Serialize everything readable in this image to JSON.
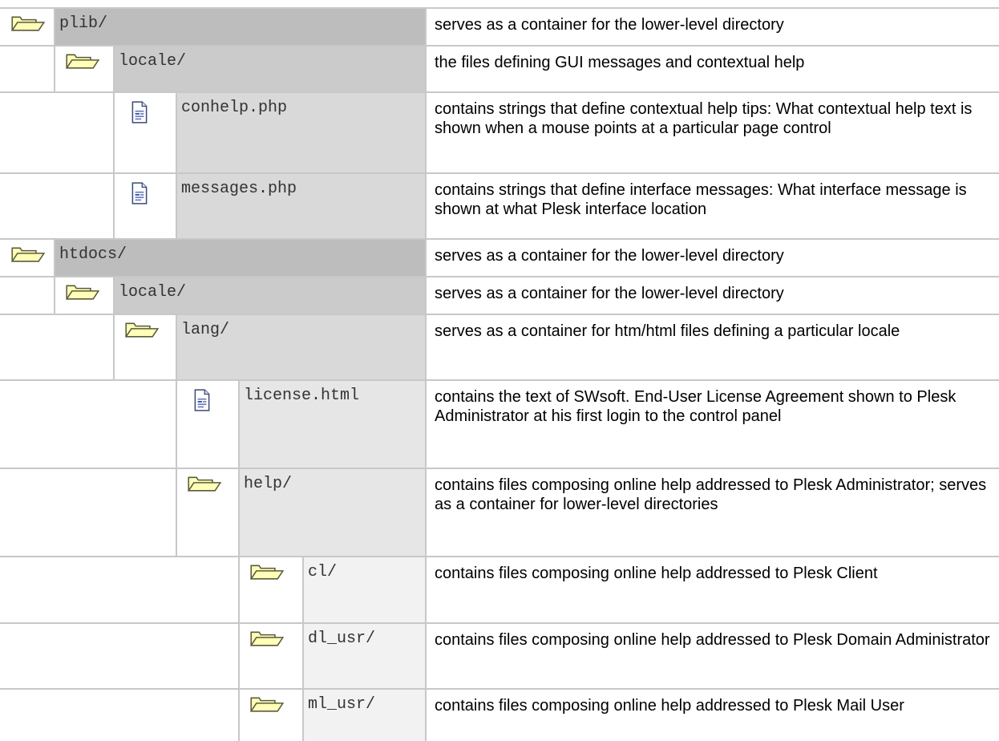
{
  "colors": {
    "level0_name_bg": "#bdbdbd",
    "level1_name_bg": "#cbcbcb",
    "level2_name_bg": "#d9d9d9",
    "level3_name_bg": "#e6e6e6",
    "level4_name_bg": "#f2f2f2",
    "grid_line": "#c8c8c8",
    "folder_fill": "#ffffb8",
    "folder_stroke": "#5a5a3c"
  },
  "rows": [
    {
      "level": 0,
      "icon": "folder-icon",
      "name": "plib/",
      "description": "serves as a container for the lower-level directory"
    },
    {
      "level": 1,
      "icon": "folder-icon",
      "name": "locale/",
      "description": "the files defining GUI messages and contextual help"
    },
    {
      "level": 2,
      "icon": "document-icon",
      "name": "conhelp.php",
      "description": "contains strings that define contextual help tips: What contextual help text is shown when a mouse points at a particular page control"
    },
    {
      "level": 2,
      "icon": "document-icon",
      "name": "messages.php",
      "description": "contains strings that define interface messages: What interface message is shown at what Plesk interface location"
    },
    {
      "level": 0,
      "icon": "folder-icon",
      "name": "htdocs/",
      "description": "serves as a container for the lower-level directory"
    },
    {
      "level": 1,
      "icon": "folder-icon",
      "name": "locale/",
      "description": "serves as a container for the lower-level directory"
    },
    {
      "level": 2,
      "icon": "folder-icon",
      "name": "lang/",
      "description": "serves as a container for htm/html files defining a particular locale"
    },
    {
      "level": 3,
      "icon": "document-icon",
      "name": "license.html",
      "description": "contains the text of SWsoft. End-User License Agreement shown to Plesk Administrator at his first login to the control panel"
    },
    {
      "level": 3,
      "icon": "folder-icon",
      "name": "help/",
      "description": "contains files composing online help addressed to Plesk Administrator; serves as a container for lower-level directories"
    },
    {
      "level": 4,
      "icon": "folder-icon",
      "name": "cl/",
      "description": "contains files composing online help addressed to Plesk Client"
    },
    {
      "level": 4,
      "icon": "folder-icon",
      "name": "dl_usr/",
      "description": "contains files composing online help addressed to Plesk Domain Administrator"
    },
    {
      "level": 4,
      "icon": "folder-icon",
      "name": "ml_usr/",
      "description": "contains files composing online help addressed to Plesk Mail User"
    }
  ]
}
